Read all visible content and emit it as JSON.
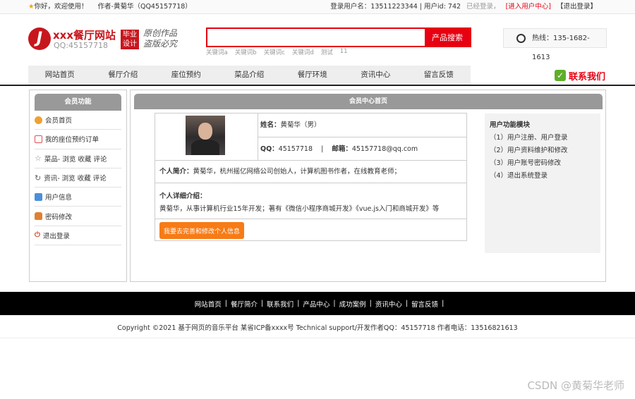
{
  "topbar": {
    "welcome": "你好，欢迎使用！",
    "author": "作者-黄菊华（QQ45157718）",
    "login_user": "登录用户名：13511223344 | 用户id: 742",
    "status": "已经登录，",
    "user_center": "[进入用户中心]",
    "logout": "【退出登录】"
  },
  "header": {
    "logo_title": "xxx餐厅网站",
    "logo_qq": "QQ:45157718",
    "badge_line1": "毕业",
    "badge_line2": "设计",
    "slogan_line1": "原创作品",
    "slogan_line2": "盗版必究",
    "search_placeholder": "",
    "search_button": "产品搜索",
    "keywords": [
      "关键词a",
      "关键词b",
      "关键词c",
      "关键词d",
      "测试",
      "11"
    ],
    "hotline": "热线：135-1682-1613"
  },
  "nav": {
    "items": [
      "网站首页",
      "餐厅介绍",
      "座位预约",
      "菜品介绍",
      "餐厅环境",
      "资讯中心",
      "留言反馈"
    ],
    "contact": "联系我们"
  },
  "sidebar": {
    "title": "会员功能",
    "items": [
      {
        "label": "会员首页",
        "icon": "home-icon",
        "color": "#f0a030"
      },
      {
        "label": "我的座位预约订单",
        "icon": "edit-icon",
        "color": "#e05050"
      },
      {
        "label": "菜品- 浏览   收藏   评论",
        "icon": "star-icon",
        "color": "#888888"
      },
      {
        "label": "资讯- 浏览   收藏   评论",
        "icon": "refresh-icon",
        "color": "#666666"
      },
      {
        "label": "用户信息",
        "icon": "doc-icon",
        "color": "#4a90d9"
      },
      {
        "label": "密码修改",
        "icon": "lock-icon",
        "color": "#e08030"
      },
      {
        "label": "退出登录",
        "icon": "power-icon",
        "color": "#d04020"
      }
    ]
  },
  "main": {
    "title": "会员中心首页",
    "name_label": "姓名：",
    "name_value": "黄菊华（男）",
    "qq_label": "QQ：",
    "qq_value": "45157718",
    "email_label": "邮箱：",
    "email_value": "45157718@qq.com",
    "intro_label": "个人简介：",
    "intro_value": "黄菊华，杭州摇亿网络公司创始人，计算机图书作者，在线教育老师；",
    "detail_label": "个人详细介绍：",
    "detail_value": "黄菊华，从事计算机行业15年开发；著有《微信小程序商城开发》《vue.js入门和商城开发》等",
    "edit_button": "我要去完善和修改个人信息"
  },
  "funcbox": {
    "title": "用户功能模块",
    "items": [
      "（1）用户注册、用户登录",
      "（2）用户资料维护和修改",
      "（3）用户账号密码修改",
      "（4）退出系统登录"
    ]
  },
  "footer": {
    "links": [
      "网站首页",
      "餐厅简介",
      "联系我们",
      "产品中心",
      "成功案例",
      "资讯中心",
      "留言反馈"
    ],
    "copyright": "Copyright ©2021 基于网页的音乐平台   某省ICP备xxxx号   Technical support/开发作者QQ：45157718    作者电话：13516821613",
    "watermark": "CSDN @黄菊华老师"
  }
}
